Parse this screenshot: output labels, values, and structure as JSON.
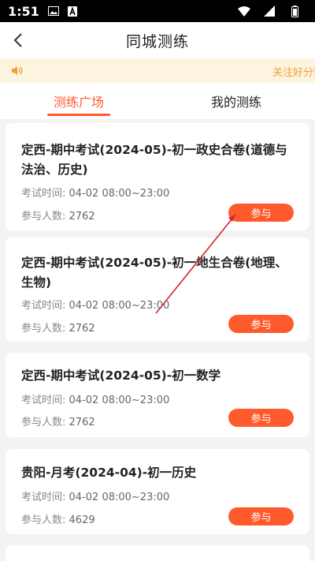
{
  "status_bar": {
    "time": "1:51",
    "icons_left": [
      "image-icon",
      "a-icon"
    ],
    "icons_right": [
      "wifi-icon",
      "signal-icon",
      "battery-icon"
    ]
  },
  "header": {
    "title": "同城测练",
    "back_icon": "chevron-left-icon"
  },
  "notice": {
    "icon": "speaker-icon",
    "text": "关注好分数"
  },
  "tabs": [
    {
      "label": "测练广场",
      "active": true
    },
    {
      "label": "我的测练",
      "active": false
    }
  ],
  "labels": {
    "time_prefix": "考试时间:",
    "count_prefix": "参与人数:",
    "join": "参与"
  },
  "exams": [
    {
      "title": "定西-期中考试(2024-05)-初一政史合卷(道德与法治、历史)",
      "time": "04-02 08:00~23:00",
      "count": "2762"
    },
    {
      "title": "定西-期中考试(2024-05)-初一地生合卷(地理、生物)",
      "time": "04-02 08:00~23:00",
      "count": "2762"
    },
    {
      "title": "定西-期中考试(2024-05)-初一数学",
      "time": "04-02 08:00~23:00",
      "count": "2762"
    },
    {
      "title": "贵阳-月考(2024-04)-初一历史",
      "time": "04-02 08:00~23:00",
      "count": "4629"
    }
  ],
  "colors": {
    "accent": "#ff5a2c",
    "notice_bg": "#fdf4e0",
    "notice_text": "#f0a030",
    "annotation_line": "#d6262b"
  }
}
